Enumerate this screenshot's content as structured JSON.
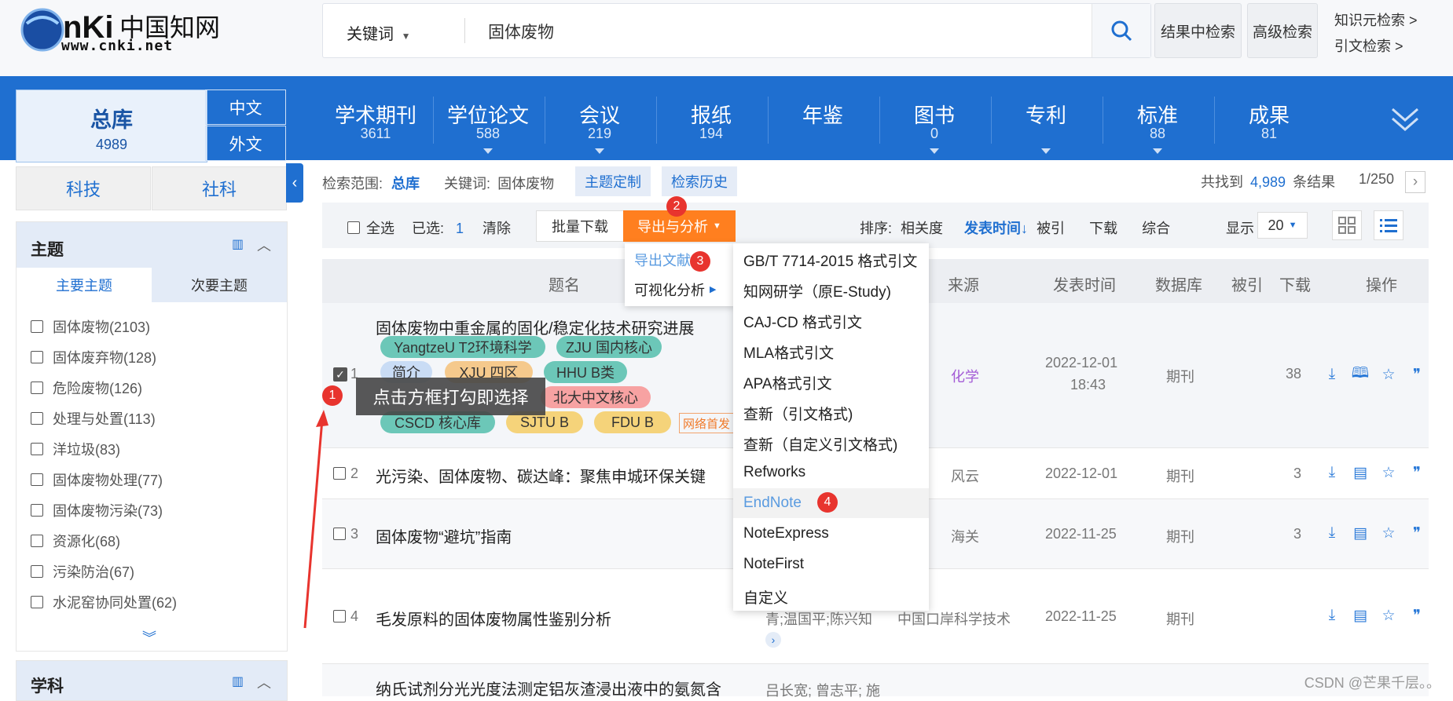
{
  "header": {
    "logo_text": "CNKi中国知网",
    "logo_url": "www.cnki.net",
    "search_field": "关键词",
    "search_value": "固体废物",
    "in_results_label": "结果中检索",
    "advanced_label": "高级检索",
    "knowledge_search": "知识元检索 >",
    "citation_search": "引文检索 >"
  },
  "nav": {
    "total": {
      "label": "总库",
      "count": "4989"
    },
    "lang_cn": "中文",
    "lang_foreign": "外文",
    "items": [
      {
        "label": "学术期刊",
        "count": "3611"
      },
      {
        "label": "学位论文",
        "count": "588"
      },
      {
        "label": "会议",
        "count": "219"
      },
      {
        "label": "报纸",
        "count": "194"
      },
      {
        "label": "年鉴",
        "count": ""
      },
      {
        "label": "图书",
        "count": "0"
      },
      {
        "label": "专利",
        "count": ""
      },
      {
        "label": "标准",
        "count": "88"
      },
      {
        "label": "成果",
        "count": "81"
      }
    ]
  },
  "sidebar": {
    "tab_sci": "科技",
    "tab_soc": "社科",
    "facet_title": "主题",
    "facet_tab_main": "主要主题",
    "facet_tab_sub": "次要主题",
    "facet_items": [
      {
        "label": "固体废物(2103)"
      },
      {
        "label": "固体废弃物(128)"
      },
      {
        "label": "危险废物(126)"
      },
      {
        "label": "处理与处置(113)"
      },
      {
        "label": "洋垃圾(83)"
      },
      {
        "label": "固体废物处理(77)"
      },
      {
        "label": "固体废物污染(73)"
      },
      {
        "label": "资源化(68)"
      },
      {
        "label": "污染防治(67)"
      },
      {
        "label": "水泥窑协同处置(62)"
      }
    ],
    "facet2_title": "学科"
  },
  "scope": {
    "range_label": "检索范围:",
    "range_value": "总库",
    "keyword_label": "关键词:",
    "keyword_value": "固体废物",
    "topic_btn": "主题定制",
    "history_btn": "检索历史",
    "found_prefix": "共找到",
    "found_count": "4,989",
    "found_suffix": "条结果",
    "page": "1/250"
  },
  "toolbar": {
    "select_all": "全选",
    "selected_label": "已选:",
    "selected_count": "1",
    "clear": "清除",
    "batch_download": "批量下载",
    "export": "导出与分析",
    "sort_label": "排序:",
    "sort_relevance": "相关度",
    "sort_date": "发表时间",
    "sort_cited": "被引",
    "sort_download": "下载",
    "sort_overall": "综合",
    "display_label": "显示",
    "display_value": "20"
  },
  "table_headers": {
    "title": "题名",
    "source": "来源",
    "date": "发表时间",
    "db": "数据库",
    "cited": "被引",
    "download": "下载",
    "ops": "操作"
  },
  "rows": [
    {
      "num": "1",
      "title": "固体废物中重金属的固化/稳定化技术研究进展",
      "source": "化学",
      "date": "2022-12-01",
      "time": "18:43",
      "db": "期刊",
      "download": "38"
    },
    {
      "num": "2",
      "title": "光污染、固体废物、碳达峰：聚焦申城环保关键",
      "source": "风云",
      "date": "2022-12-01",
      "db": "期刊",
      "download": "3"
    },
    {
      "num": "3",
      "title": "固体废物“避坑”指南",
      "source": "海关",
      "date": "2022-11-25",
      "db": "期刊",
      "download": "3"
    },
    {
      "num": "4",
      "title": "毛发原料的固体废物属性鉴别分析",
      "authors": "青;温国平;陈兴知",
      "source": "中国口岸科学技术",
      "date": "2022-11-25",
      "db": "期刊",
      "download": ""
    },
    {
      "num": "5",
      "title": "纳氏试剂分光光度法测定铝灰渣浸出液中的氨氮含",
      "authors": "吕长宽; 曾志平; 施"
    }
  ],
  "row1_tags": [
    "YangtzeU T2环境科学",
    "ZJU 国内核心",
    "简介",
    "XJU 四区",
    "HHU B类",
    "北大中文核心",
    "CSCD 核心库",
    "SJTU B",
    "FDU B",
    "网络首发"
  ],
  "submenu": {
    "export_doc": "导出文献",
    "visual": "可视化分析"
  },
  "format_menu": [
    "GB/T 7714-2015 格式引文",
    "知网研学（原E-Study)",
    "CAJ-CD 格式引文",
    "MLA格式引文",
    "APA格式引文",
    "查新（引文格式)",
    "查新（自定义引文格式)",
    "Refworks",
    "EndNote",
    "NoteExpress",
    "NoteFirst",
    "自定义"
  ],
  "annotations": {
    "b1": "1",
    "b2": "2",
    "b3": "3",
    "b4": "4",
    "tooltip": "点击方框打勾即选择"
  },
  "watermark": "CSDN @芒果千层。。",
  "colors": {
    "brand_blue": "#1f6fd0",
    "export_orange": "#ff7f1f",
    "badge_red": "#e8342e"
  }
}
